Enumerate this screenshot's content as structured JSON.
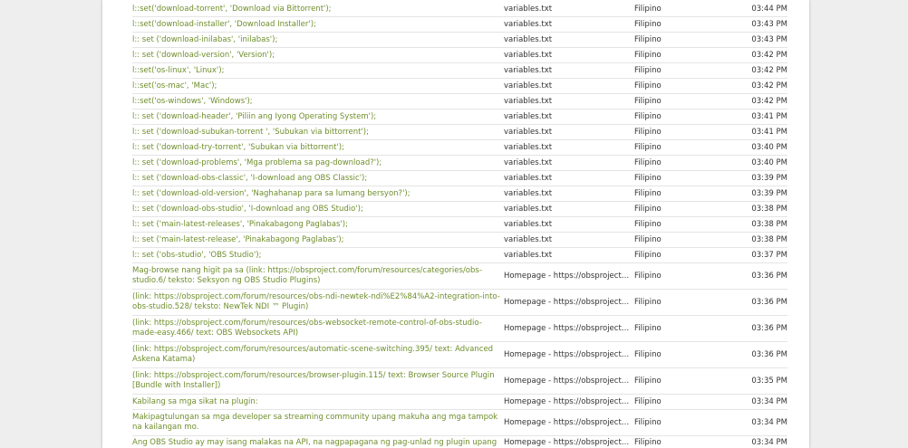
{
  "rows": [
    {
      "text": "l::set('download-torrent', 'Download via Bittorrent');",
      "file": "variables.txt",
      "language": "Filipino",
      "time": "03:44 PM"
    },
    {
      "text": "l::set('download-installer', 'Download Installer');",
      "file": "variables.txt",
      "language": "Filipino",
      "time": "03:43 PM"
    },
    {
      "text": "l:: set ('download-inilabas', 'inilabas');",
      "file": "variables.txt",
      "language": "Filipino",
      "time": "03:43 PM"
    },
    {
      "text": "l:: set ('download-version', 'Version');",
      "file": "variables.txt",
      "language": "Filipino",
      "time": "03:42 PM"
    },
    {
      "text": "l::set('os-linux', 'Linux');",
      "file": "variables.txt",
      "language": "Filipino",
      "time": "03:42 PM"
    },
    {
      "text": "l::set('os-mac', 'Mac');",
      "file": "variables.txt",
      "language": "Filipino",
      "time": "03:42 PM"
    },
    {
      "text": "l::set('os-windows', 'Windows');",
      "file": "variables.txt",
      "language": "Filipino",
      "time": "03:42 PM"
    },
    {
      "text": "l:: set ('download-header', 'Piliin ang Iyong Operating System');",
      "file": "variables.txt",
      "language": "Filipino",
      "time": "03:41 PM"
    },
    {
      "text": "l:: set ('download-subukan-torrent ', 'Subukan via bittorrent');",
      "file": "variables.txt",
      "language": "Filipino",
      "time": "03:41 PM"
    },
    {
      "text": "l:: set ('download-try-torrent', 'Subukan via bittorrent');",
      "file": "variables.txt",
      "language": "Filipino",
      "time": "03:40 PM"
    },
    {
      "text": "l:: set ('download-problems', 'Mga problema sa pag-download?');",
      "file": "variables.txt",
      "language": "Filipino",
      "time": "03:40 PM"
    },
    {
      "text": "l:: set ('download-obs-classic', 'I-download ang OBS Classic');",
      "file": "variables.txt",
      "language": "Filipino",
      "time": "03:39 PM"
    },
    {
      "text": "l:: set ('download-old-version', 'Naghahanap para sa lumang bersyon?');",
      "file": "variables.txt",
      "language": "Filipino",
      "time": "03:39 PM"
    },
    {
      "text": "l:: set ('download-obs-studio', 'I-download ang OBS Studio');",
      "file": "variables.txt",
      "language": "Filipino",
      "time": "03:38 PM"
    },
    {
      "text": "l:: set ('main-latest-releases', 'Pinakabagong Paglabas');",
      "file": "variables.txt",
      "language": "Filipino",
      "time": "03:38 PM"
    },
    {
      "text": "l:: set ('main-latest-release', 'Pinakabagong Paglabas');",
      "file": "variables.txt",
      "language": "Filipino",
      "time": "03:38 PM"
    },
    {
      "text": "l:: set ('obs-studio', 'OBS Studio');",
      "file": "variables.txt",
      "language": "Filipino",
      "time": "03:37 PM"
    },
    {
      "text": "Mag-browse nang higit pa sa (link: https://obsproject.com/forum/resources/categories/obs-studio.6/ teksto: Seksyon ng OBS Studio Plugins)",
      "file": "Homepage - https://obsproject.c...",
      "language": "Filipino",
      "time": "03:36 PM",
      "double": true
    },
    {
      "text": "(link: https://obsproject.com/forum/resources/obs-ndi-newtek-ndi%E2%84%A2-integration-into-obs-studio.528/ teksto: NewTek NDI ™ Plugin)",
      "file": "Homepage - https://obsproject.c...",
      "language": "Filipino",
      "time": "03:36 PM",
      "double": true
    },
    {
      "text": "(link: https://obsproject.com/forum/resources/obs-websocket-remote-control-of-obs-studio-made-easy.466/ text: OBS Websockets API)",
      "file": "Homepage - https://obsproject.c...",
      "language": "Filipino",
      "time": "03:36 PM",
      "double": true
    },
    {
      "text": "(link: https://obsproject.com/forum/resources/automatic-scene-switching.395/ text: Advanced Askena Katama)",
      "file": "Homepage - https://obsproject.c...",
      "language": "Filipino",
      "time": "03:36 PM",
      "double": true
    },
    {
      "text": "(link: https://obsproject.com/forum/resources/browser-plugin.115/ text: Browser Source Plugin [Bundle with Installer])",
      "file": "Homepage - https://obsproject.c...",
      "language": "Filipino",
      "time": "03:35 PM",
      "double": true
    },
    {
      "text": "Kabilang sa mga sikat na plugin:",
      "file": "Homepage - https://obsproject.c...",
      "language": "Filipino",
      "time": "03:34 PM"
    },
    {
      "text": "Makipagtulungan sa mga developer sa streaming community upang makuha ang mga tampok na kailangan mo.",
      "file": "Homepage - https://obsproject.c...",
      "language": "Filipino",
      "time": "03:34 PM",
      "double": true
    },
    {
      "text": "Ang OBS Studio ay may isang malakas na API, na nagpapagana ng pag-unlad ng plugin upang",
      "file": "Homepage - https://obsproject.c...",
      "language": "Filipino",
      "time": "03:34 PM",
      "cut": true
    }
  ]
}
